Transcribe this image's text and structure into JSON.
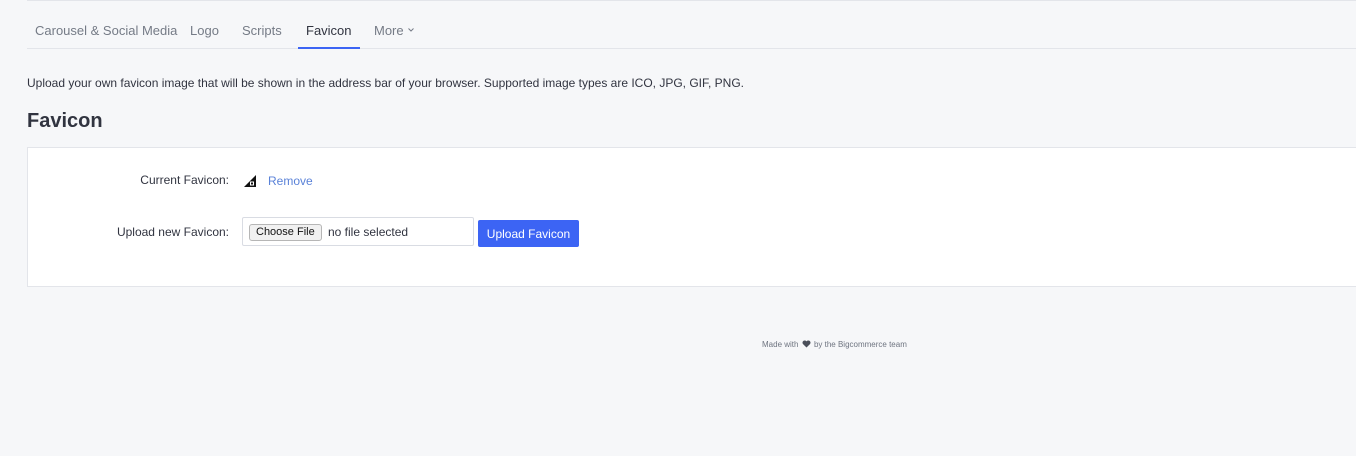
{
  "tabs": [
    {
      "label": "Carousel & Social Media",
      "active": false
    },
    {
      "label": "Logo",
      "active": false
    },
    {
      "label": "Scripts",
      "active": false
    },
    {
      "label": "Favicon",
      "active": true
    },
    {
      "label": "More",
      "active": false,
      "icon": "chevron-down-icon"
    }
  ],
  "description": "Upload your own favicon image that will be shown in the address bar of your browser. Supported image types are ICO, JPG, GIF, PNG.",
  "section": {
    "title": "Favicon",
    "current_label": "Current Favicon:",
    "current_icon": "bigcommerce-favicon-icon",
    "remove_label": "Remove",
    "upload_label": "Upload new Favicon:",
    "choose_file_label": "Choose File",
    "file_status": "no file selected",
    "upload_button_label": "Upload Favicon"
  },
  "footer": {
    "prefix": "Made with",
    "icon": "heart-icon",
    "suffix": "by the Bigcommerce team"
  },
  "colors": {
    "accent": "#3c64f4",
    "link": "#5a82d8",
    "background": "#f6f7f9",
    "panel": "#ffffff"
  }
}
